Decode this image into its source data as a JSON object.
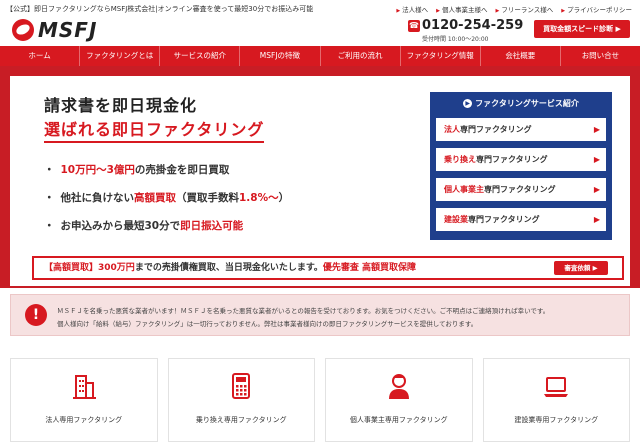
{
  "topbar": {
    "tagline": "【公式】即日ファクタリングならMSFJ株式会社|オンライン審査を使って最短30分でお振込み可能",
    "links": [
      "法人様へ",
      "個人事業主様へ",
      "フリーランス様へ",
      "プライバシーポリシー"
    ]
  },
  "header": {
    "logo_text": "MSFJ",
    "phone": "0120-254-259",
    "hours": "受付時間 10:00～20:00",
    "diagnosis_button": "買取金額スピード診断 ▶"
  },
  "nav": [
    "ホーム",
    "ファクタリングとは",
    "サービスの紹介",
    "MSFJの特徴",
    "ご利用の流れ",
    "ファクタリング情報",
    "会社概要",
    "お問い合せ"
  ],
  "hero": {
    "title_line1": "請求書を即日現金化",
    "title_line2": "選ばれる即日ファクタリング",
    "bullets": [
      {
        "dot": "・",
        "a": "",
        "em": "10万円～3億円",
        "b": "の売掛金を即日買取",
        "em2": "",
        "c": ""
      },
      {
        "dot": "・",
        "a": "他社に負けない",
        "em": "高額買取",
        "b": "（買取手数料",
        "em2": "1.8%～",
        "c": "）"
      },
      {
        "dot": "・",
        "a": "お申込みから最短30分で",
        "em": "即日振込可能",
        "b": "",
        "em2": "",
        "c": ""
      }
    ],
    "service_panel": {
      "heading": "ファクタリングサービス紹介",
      "items": [
        {
          "highlight": "法人",
          "rest": "専門ファクタリング"
        },
        {
          "highlight": "乗り換え",
          "rest": "専門ファクタリング"
        },
        {
          "highlight": "個人事業主",
          "rest": "専門ファクタリング"
        },
        {
          "highlight": "建設業",
          "rest": "専門ファクタリング"
        }
      ]
    },
    "banner": {
      "p1": "【高額買取】",
      "p2": "300万円",
      "p3": "までの売掛債権買取、当日現金化いたします。",
      "p4": "優先審査 高額買取保障",
      "button": "審査依頼 ▶"
    }
  },
  "notice": {
    "line1": "ＭＳＦＪを名乗った悪質な業者がいます！ＭＳＦＪを名乗った悪質な業者がいるとの報告を受けております。お気をつけください。ご不明点はご連絡頂ければ幸いです。",
    "line2": "個人様向け「給料（給与）ファクタリング」は一切行っておりません。弊社は事業者様向けの即日ファクタリングサービスを提供しております。"
  },
  "cards": [
    {
      "label": "法人専用ファクタリング",
      "icon": "building-icon"
    },
    {
      "label": "乗り換え専用ファクタリング",
      "icon": "calculator-icon"
    },
    {
      "label": "個人事業主専用ファクタリング",
      "icon": "person-icon"
    },
    {
      "label": "建設業専用ファクタリング",
      "icon": "laptop-icon"
    }
  ],
  "colors": {
    "accent": "#d71920",
    "panel": "#1f3f8c"
  }
}
